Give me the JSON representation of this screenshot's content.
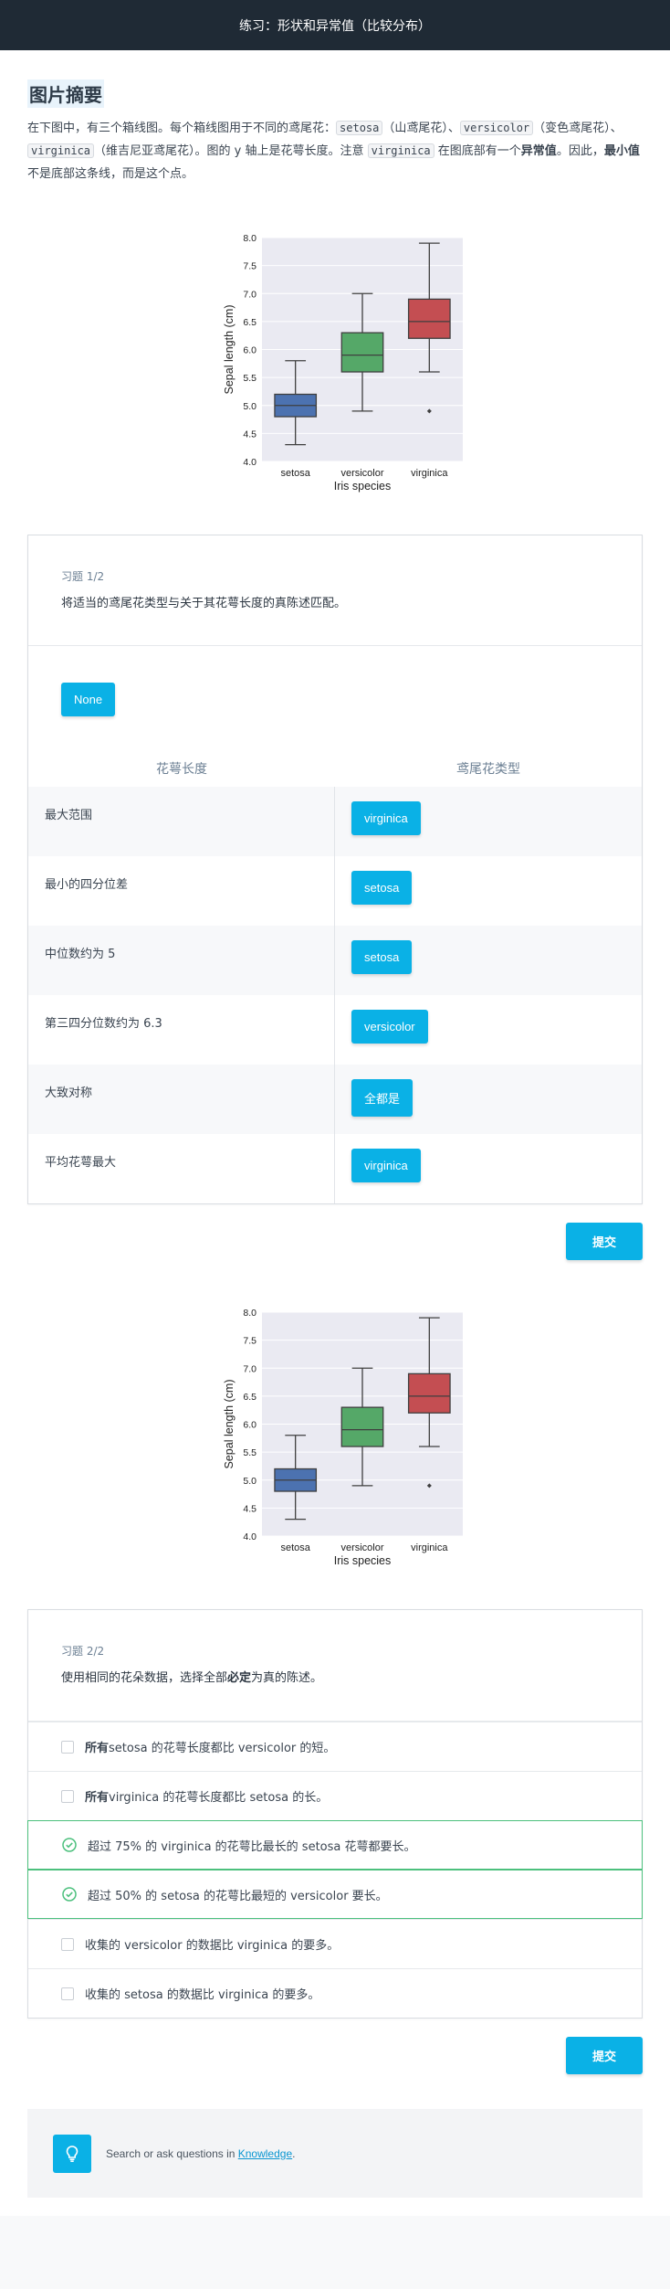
{
  "header": {
    "title": "练习：形状和异常值（比较分布）"
  },
  "summary": {
    "title": "图片摘要",
    "p1": "在下图中，有三个箱线图。每个箱线图用于不同的鸢尾花：",
    "setosa": "setosa",
    "setosa_cn": "（山鸢尾花）、",
    "versicolor": "versicolor",
    "versicolor_cn": "（变色鸢尾花）、",
    "virginica": "virginica",
    "virginica_cn": "（维吉尼亚鸢尾花）。图的 y 轴上是花萼长度。注意 ",
    "virginica2": "virginica",
    "p2": " 在图底部有一个",
    "outlier": "异常值",
    "p3": "。因此，",
    "minval": "最小值",
    "p4": "不是底部这条线，而是这个点。"
  },
  "chart_data": [
    {
      "type": "box",
      "xlabel": "Iris species",
      "ylabel": "Sepal length (cm)",
      "ylim": [
        4.0,
        8.0
      ],
      "yticks": [
        "4.0",
        "4.5",
        "5.0",
        "5.5",
        "6.0",
        "6.5",
        "7.0",
        "7.5",
        "8.0"
      ],
      "categories": [
        "setosa",
        "versicolor",
        "virginica"
      ],
      "boxes": [
        {
          "name": "setosa",
          "color": "#4c72b0",
          "min": 4.3,
          "q1": 4.8,
          "median": 5.0,
          "q3": 5.2,
          "max": 5.8,
          "outliers": []
        },
        {
          "name": "versicolor",
          "color": "#55a868",
          "min": 4.9,
          "q1": 5.6,
          "median": 5.9,
          "q3": 6.3,
          "max": 7.0,
          "outliers": []
        },
        {
          "name": "virginica",
          "color": "#c44e52",
          "min": 5.6,
          "q1": 6.2,
          "median": 6.5,
          "q3": 6.9,
          "max": 7.9,
          "outliers": [
            4.9
          ]
        }
      ],
      "grid": true,
      "background": "#eaeaf2"
    }
  ],
  "exercise1": {
    "number": "习题 1/2",
    "prompt": "将适当的鸢尾花类型与关于其花萼长度的真陈述匹配。",
    "pool_item": "None",
    "col_left": "花萼长度",
    "col_right": "鸢尾花类型",
    "rows": [
      {
        "statement": "最大范围",
        "answer": "virginica"
      },
      {
        "statement": "最小的四分位差",
        "answer": "setosa"
      },
      {
        "statement": "中位数约为 5",
        "answer": "setosa"
      },
      {
        "statement": "第三四分位数约为 6.3",
        "answer": "versicolor"
      },
      {
        "statement": "大致对称",
        "answer": "全都是"
      },
      {
        "statement": "平均花萼最大",
        "answer": "virginica"
      }
    ],
    "submit": "提交"
  },
  "exercise2": {
    "number": "习题 2/2",
    "prompt_a": "使用相同的花朵数据，选择全部",
    "prompt_b": "必定",
    "prompt_c": "为真的陈述。",
    "options": [
      {
        "bold": "所有",
        "text": " setosa 的花萼长度都比 versicolor 的短。",
        "state": "unchecked"
      },
      {
        "bold": "所有",
        "text": " virginica 的花萼长度都比 setosa 的长。",
        "state": "unchecked"
      },
      {
        "bold": "",
        "text": "超过 75% 的 virginica 的花萼比最长的 setosa 花萼都要长。",
        "state": "correct"
      },
      {
        "bold": "",
        "text": "超过 50% 的 setosa 的花萼比最短的 versicolor 要长。",
        "state": "correct"
      },
      {
        "bold": "",
        "text": "收集的 versicolor 的数据比 virginica 的要多。",
        "state": "unchecked"
      },
      {
        "bold": "",
        "text": "收集的 setosa 的数据比 virginica 的要多。",
        "state": "unchecked"
      }
    ],
    "submit": "提交"
  },
  "knowledge": {
    "text": "Search or ask questions in ",
    "link": "Knowledge",
    "end": "."
  },
  "colors": {
    "accent": "#0ab1e6",
    "header_bg": "#1f2a35",
    "correct": "#4cc07d"
  }
}
